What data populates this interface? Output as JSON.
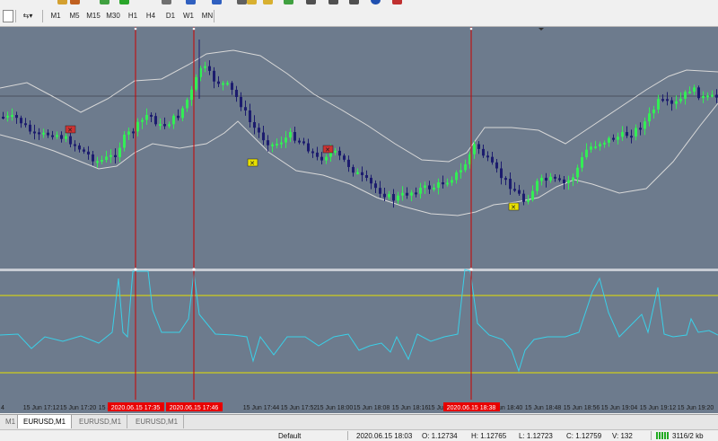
{
  "toolbar": {
    "icons": [
      "open-folder-icon",
      "save-icon",
      "new-order-icon",
      "add-icon",
      "crosshair-icon",
      "zoom-in-icon",
      "zoom-out-icon",
      "tile-icon",
      "autoscroll-icon",
      "chart-shift-icon",
      "refresh-icon",
      "settings-icon"
    ],
    "timeframes": [
      "M1",
      "M5",
      "M15",
      "M30",
      "H1",
      "H4",
      "D1",
      "W1",
      "MN"
    ]
  },
  "chart": {
    "symbol": "EURUSD",
    "price_hline_color": "#4a5060",
    "band_color": "#d8d8d8",
    "bull_color": "#33ee55",
    "bear_color": "#1c1c6e",
    "osc_color": "#3ad0e8",
    "level_color": "#e8e000",
    "vline_color": "#cc0000",
    "bg_color": "#6d7b8d",
    "time_labels": [
      "4",
      "15 Jun 17:12",
      "15 Jun 17:20",
      "15 Jun 17:28",
      "15 Jun 17:44",
      "15 Jun 17:52",
      "15 Jun 18:00",
      "15 Jun 18:08",
      "15 Jun 18:16",
      "15 Jun 18:24",
      "15 Jun 18:40",
      "15 Jun 18:48",
      "15 Jun 18:56",
      "15 Jun 19:04",
      "15 Jun 19:12",
      "15 Jun 19:20"
    ],
    "marker_time_labels": [
      "2020.06.15 17:35",
      "2020.06.15 17:46",
      "2020.06.15 18:38"
    ],
    "markers": [
      {
        "kind": "sell",
        "symbol": "✕"
      },
      {
        "kind": "buy",
        "symbol": "✕"
      },
      {
        "kind": "sell",
        "symbol": "✕"
      },
      {
        "kind": "buy",
        "symbol": "✕"
      }
    ]
  },
  "tabs": [
    {
      "label": "M1",
      "active": false
    },
    {
      "label": "EURUSD,M1",
      "active": true
    },
    {
      "label": "EURUSD,M1",
      "active": false
    },
    {
      "label": "EURUSD,M1",
      "active": false
    }
  ],
  "status": {
    "profile": "Default",
    "datetime": "2020.06.15 18:03",
    "open": "O: 1.12734",
    "high": "H: 1.12765",
    "low": "L: 1.12723",
    "close": "C: 1.12759",
    "volume": "V: 132",
    "traffic": "3116/2 kb"
  }
}
